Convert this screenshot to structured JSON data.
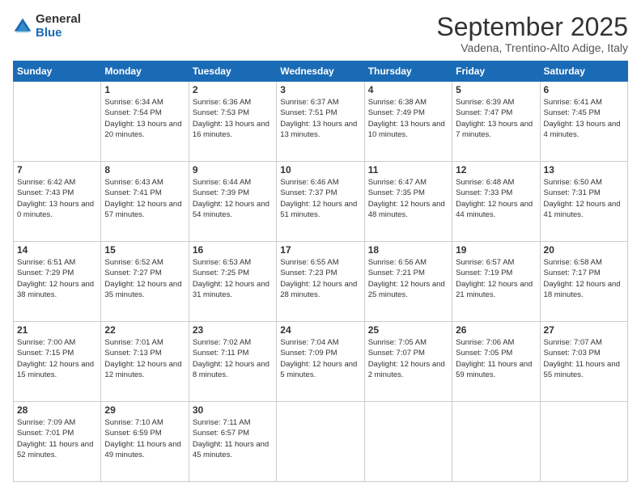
{
  "header": {
    "logo_line1": "General",
    "logo_line2": "Blue",
    "main_title": "September 2025",
    "subtitle": "Vadena, Trentino-Alto Adige, Italy"
  },
  "days": [
    "Sunday",
    "Monday",
    "Tuesday",
    "Wednesday",
    "Thursday",
    "Friday",
    "Saturday"
  ],
  "weeks": [
    [
      {
        "day": "",
        "sunrise": "",
        "sunset": "",
        "daylight": ""
      },
      {
        "day": "1",
        "sunrise": "Sunrise: 6:34 AM",
        "sunset": "Sunset: 7:54 PM",
        "daylight": "Daylight: 13 hours and 20 minutes."
      },
      {
        "day": "2",
        "sunrise": "Sunrise: 6:36 AM",
        "sunset": "Sunset: 7:53 PM",
        "daylight": "Daylight: 13 hours and 16 minutes."
      },
      {
        "day": "3",
        "sunrise": "Sunrise: 6:37 AM",
        "sunset": "Sunset: 7:51 PM",
        "daylight": "Daylight: 13 hours and 13 minutes."
      },
      {
        "day": "4",
        "sunrise": "Sunrise: 6:38 AM",
        "sunset": "Sunset: 7:49 PM",
        "daylight": "Daylight: 13 hours and 10 minutes."
      },
      {
        "day": "5",
        "sunrise": "Sunrise: 6:39 AM",
        "sunset": "Sunset: 7:47 PM",
        "daylight": "Daylight: 13 hours and 7 minutes."
      },
      {
        "day": "6",
        "sunrise": "Sunrise: 6:41 AM",
        "sunset": "Sunset: 7:45 PM",
        "daylight": "Daylight: 13 hours and 4 minutes."
      }
    ],
    [
      {
        "day": "7",
        "sunrise": "Sunrise: 6:42 AM",
        "sunset": "Sunset: 7:43 PM",
        "daylight": "Daylight: 13 hours and 0 minutes."
      },
      {
        "day": "8",
        "sunrise": "Sunrise: 6:43 AM",
        "sunset": "Sunset: 7:41 PM",
        "daylight": "Daylight: 12 hours and 57 minutes."
      },
      {
        "day": "9",
        "sunrise": "Sunrise: 6:44 AM",
        "sunset": "Sunset: 7:39 PM",
        "daylight": "Daylight: 12 hours and 54 minutes."
      },
      {
        "day": "10",
        "sunrise": "Sunrise: 6:46 AM",
        "sunset": "Sunset: 7:37 PM",
        "daylight": "Daylight: 12 hours and 51 minutes."
      },
      {
        "day": "11",
        "sunrise": "Sunrise: 6:47 AM",
        "sunset": "Sunset: 7:35 PM",
        "daylight": "Daylight: 12 hours and 48 minutes."
      },
      {
        "day": "12",
        "sunrise": "Sunrise: 6:48 AM",
        "sunset": "Sunset: 7:33 PM",
        "daylight": "Daylight: 12 hours and 44 minutes."
      },
      {
        "day": "13",
        "sunrise": "Sunrise: 6:50 AM",
        "sunset": "Sunset: 7:31 PM",
        "daylight": "Daylight: 12 hours and 41 minutes."
      }
    ],
    [
      {
        "day": "14",
        "sunrise": "Sunrise: 6:51 AM",
        "sunset": "Sunset: 7:29 PM",
        "daylight": "Daylight: 12 hours and 38 minutes."
      },
      {
        "day": "15",
        "sunrise": "Sunrise: 6:52 AM",
        "sunset": "Sunset: 7:27 PM",
        "daylight": "Daylight: 12 hours and 35 minutes."
      },
      {
        "day": "16",
        "sunrise": "Sunrise: 6:53 AM",
        "sunset": "Sunset: 7:25 PM",
        "daylight": "Daylight: 12 hours and 31 minutes."
      },
      {
        "day": "17",
        "sunrise": "Sunrise: 6:55 AM",
        "sunset": "Sunset: 7:23 PM",
        "daylight": "Daylight: 12 hours and 28 minutes."
      },
      {
        "day": "18",
        "sunrise": "Sunrise: 6:56 AM",
        "sunset": "Sunset: 7:21 PM",
        "daylight": "Daylight: 12 hours and 25 minutes."
      },
      {
        "day": "19",
        "sunrise": "Sunrise: 6:57 AM",
        "sunset": "Sunset: 7:19 PM",
        "daylight": "Daylight: 12 hours and 21 minutes."
      },
      {
        "day": "20",
        "sunrise": "Sunrise: 6:58 AM",
        "sunset": "Sunset: 7:17 PM",
        "daylight": "Daylight: 12 hours and 18 minutes."
      }
    ],
    [
      {
        "day": "21",
        "sunrise": "Sunrise: 7:00 AM",
        "sunset": "Sunset: 7:15 PM",
        "daylight": "Daylight: 12 hours and 15 minutes."
      },
      {
        "day": "22",
        "sunrise": "Sunrise: 7:01 AM",
        "sunset": "Sunset: 7:13 PM",
        "daylight": "Daylight: 12 hours and 12 minutes."
      },
      {
        "day": "23",
        "sunrise": "Sunrise: 7:02 AM",
        "sunset": "Sunset: 7:11 PM",
        "daylight": "Daylight: 12 hours and 8 minutes."
      },
      {
        "day": "24",
        "sunrise": "Sunrise: 7:04 AM",
        "sunset": "Sunset: 7:09 PM",
        "daylight": "Daylight: 12 hours and 5 minutes."
      },
      {
        "day": "25",
        "sunrise": "Sunrise: 7:05 AM",
        "sunset": "Sunset: 7:07 PM",
        "daylight": "Daylight: 12 hours and 2 minutes."
      },
      {
        "day": "26",
        "sunrise": "Sunrise: 7:06 AM",
        "sunset": "Sunset: 7:05 PM",
        "daylight": "Daylight: 11 hours and 59 minutes."
      },
      {
        "day": "27",
        "sunrise": "Sunrise: 7:07 AM",
        "sunset": "Sunset: 7:03 PM",
        "daylight": "Daylight: 11 hours and 55 minutes."
      }
    ],
    [
      {
        "day": "28",
        "sunrise": "Sunrise: 7:09 AM",
        "sunset": "Sunset: 7:01 PM",
        "daylight": "Daylight: 11 hours and 52 minutes."
      },
      {
        "day": "29",
        "sunrise": "Sunrise: 7:10 AM",
        "sunset": "Sunset: 6:59 PM",
        "daylight": "Daylight: 11 hours and 49 minutes."
      },
      {
        "day": "30",
        "sunrise": "Sunrise: 7:11 AM",
        "sunset": "Sunset: 6:57 PM",
        "daylight": "Daylight: 11 hours and 45 minutes."
      },
      {
        "day": "",
        "sunrise": "",
        "sunset": "",
        "daylight": ""
      },
      {
        "day": "",
        "sunrise": "",
        "sunset": "",
        "daylight": ""
      },
      {
        "day": "",
        "sunrise": "",
        "sunset": "",
        "daylight": ""
      },
      {
        "day": "",
        "sunrise": "",
        "sunset": "",
        "daylight": ""
      }
    ]
  ]
}
